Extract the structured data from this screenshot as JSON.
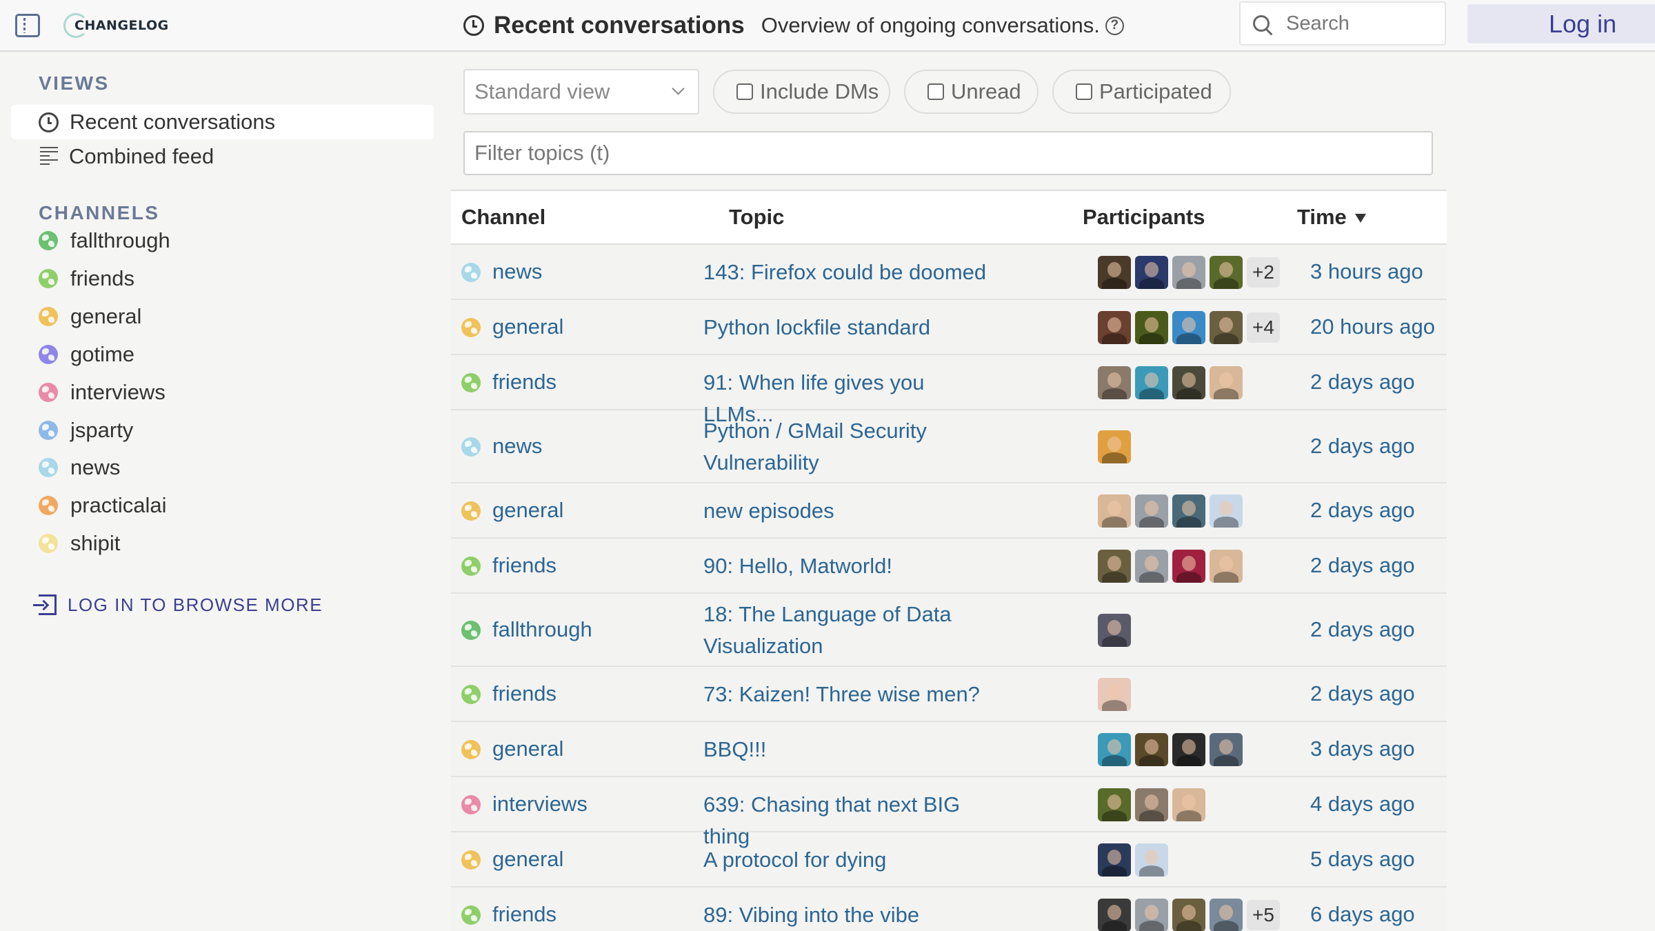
{
  "header": {
    "logo_text": "CHANGELOG",
    "title": "Recent conversations",
    "subtitle": "Overview of ongoing conversations.",
    "search_placeholder": "Search",
    "login_label": "Log in"
  },
  "sidebar": {
    "views_heading": "VIEWS",
    "views": [
      {
        "label": "Recent conversations",
        "icon": "clock-icon",
        "active": true
      },
      {
        "label": "Combined feed",
        "icon": "feed-icon",
        "active": false
      }
    ],
    "channels_heading": "CHANNELS",
    "channels": [
      {
        "name": "fallthrough",
        "color": "#6cc070"
      },
      {
        "name": "friends",
        "color": "#8fcf6a"
      },
      {
        "name": "general",
        "color": "#f0c25a"
      },
      {
        "name": "gotime",
        "color": "#8e86e8"
      },
      {
        "name": "interviews",
        "color": "#e88aa8"
      },
      {
        "name": "jsparty",
        "color": "#8fb8e8"
      },
      {
        "name": "news",
        "color": "#a8d8e8"
      },
      {
        "name": "practicalai",
        "color": "#f0a860"
      },
      {
        "name": "shipit",
        "color": "#f3e39a"
      }
    ],
    "browse_more": "LOG IN TO BROWSE MORE"
  },
  "filters": {
    "view_select": "Standard view",
    "include_dms": "Include DMs",
    "unread": "Unread",
    "participated": "Participated",
    "topic_filter_placeholder": "Filter topics (t)"
  },
  "table": {
    "columns": {
      "channel": "Channel",
      "topic": "Topic",
      "participants": "Participants",
      "time": "Time"
    },
    "rows": [
      {
        "channel": "news",
        "color": "#a8d8e8",
        "topic": "143: Firefox could be doomed",
        "avatars": [
          "#4a3a2a",
          "#2a3a6a",
          "#9aa0a8",
          "#5a6a2a"
        ],
        "more": "+2",
        "time": "3 hours ago"
      },
      {
        "channel": "general",
        "color": "#f0c25a",
        "topic": "Python lockfile standard",
        "avatars": [
          "#6a4030",
          "#4a5a1a",
          "#3a8ac8",
          "#6a6040"
        ],
        "more": "+4",
        "time": "20 hours ago"
      },
      {
        "channel": "friends",
        "color": "#8fcf6a",
        "topic": "91: When life gives you LLMs...",
        "avatars": [
          "#8a7a6a",
          "#3a9ab8",
          "#4a4a3a",
          "#d8b898"
        ],
        "more": "",
        "time": "2 days ago"
      },
      {
        "channel": "news",
        "color": "#a8d8e8",
        "topic": "Python / GMail Security Vulnerability",
        "avatars": [
          "#e0a040"
        ],
        "more": "",
        "time": "2 days ago"
      },
      {
        "channel": "general",
        "color": "#f0c25a",
        "topic": "new episodes",
        "avatars": [
          "#d8b898",
          "#9aa0a8",
          "#4a6a7a",
          "#c8d8e8"
        ],
        "more": "",
        "time": "2 days ago"
      },
      {
        "channel": "friends",
        "color": "#8fcf6a",
        "topic": "90: Hello, Matworld!",
        "avatars": [
          "#6a6040",
          "#9aa0a8",
          "#a02040",
          "#d8b898"
        ],
        "more": "",
        "time": "2 days ago"
      },
      {
        "channel": "fallthrough",
        "color": "#6cc070",
        "topic": "18: The Language of Data Visualization",
        "avatars": [
          "#5a5a6a"
        ],
        "more": "",
        "time": "2 days ago"
      },
      {
        "channel": "friends",
        "color": "#8fcf6a",
        "topic": "73: Kaizen! Three wise men?",
        "avatars": [
          "#e8c8b8"
        ],
        "more": "",
        "time": "2 days ago"
      },
      {
        "channel": "general",
        "color": "#f0c25a",
        "topic": "BBQ!!!",
        "avatars": [
          "#3a9ab8",
          "#5a4a2a",
          "#2a2a2a",
          "#5a6a7a"
        ],
        "more": "",
        "time": "3 days ago"
      },
      {
        "channel": "interviews",
        "color": "#e88aa8",
        "topic": "639: Chasing that next BIG thing",
        "avatars": [
          "#5a6a2a",
          "#8a7a6a",
          "#d8b898"
        ],
        "more": "",
        "time": "4 days ago"
      },
      {
        "channel": "general",
        "color": "#f0c25a",
        "topic": "A protocol for dying",
        "avatars": [
          "#2a3a5a",
          "#c8d8e8"
        ],
        "more": "",
        "time": "5 days ago"
      },
      {
        "channel": "friends",
        "color": "#8fcf6a",
        "topic": "89: Vibing into the vibe",
        "avatars": [
          "#3a3a3a",
          "#9aa0a8",
          "#6a6040",
          "#7a8a9a"
        ],
        "more": "+5",
        "time": "6 days ago"
      }
    ]
  }
}
